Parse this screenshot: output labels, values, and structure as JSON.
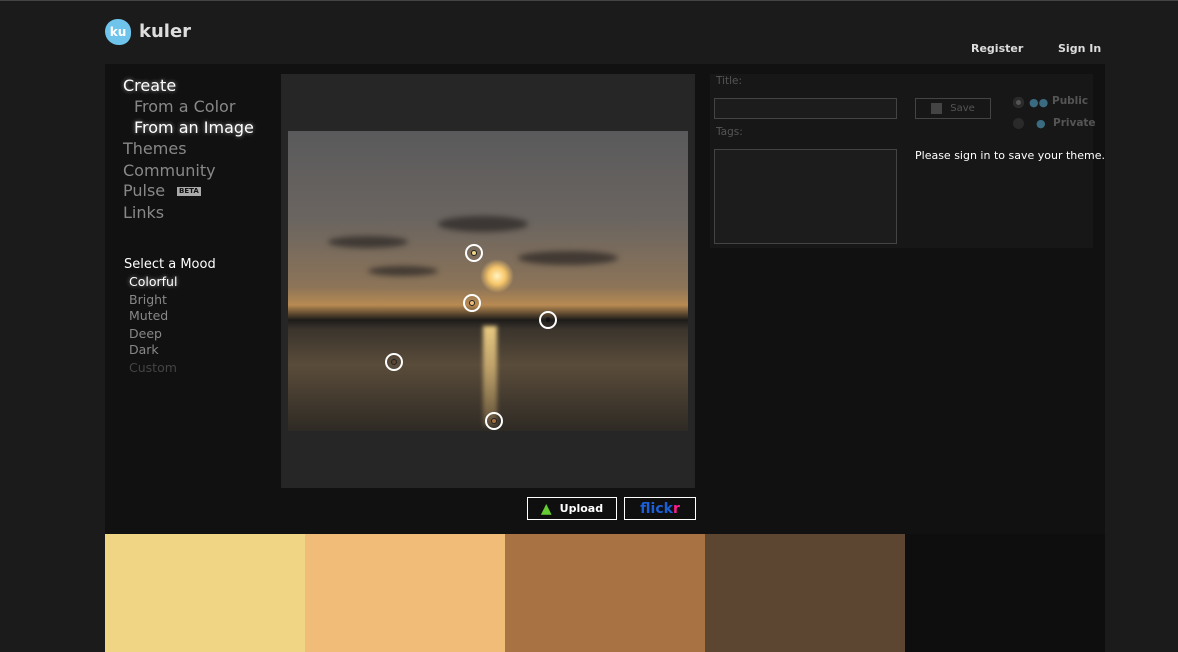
{
  "header": {
    "logo_text": "ku",
    "brand": "kuler",
    "register": "Register",
    "sign_in": "Sign In"
  },
  "nav": {
    "items": [
      {
        "label": "Create",
        "active": true
      },
      {
        "label": "From a Color",
        "active": false
      },
      {
        "label": "From an Image",
        "active": true
      },
      {
        "label": "Themes",
        "active": false
      },
      {
        "label": "Community",
        "active": false
      },
      {
        "label": "Pulse",
        "active": false
      },
      {
        "label": "Links",
        "active": false
      }
    ],
    "beta_badge": "BETA"
  },
  "mood": {
    "heading": "Select a Mood",
    "options": [
      "Colorful",
      "Bright",
      "Muted",
      "Deep",
      "Dark",
      "Custom"
    ],
    "selected": "Colorful"
  },
  "image_actions": {
    "upload": "Upload",
    "flickr": "flickr"
  },
  "form": {
    "title_label": "Title:",
    "title_value": "",
    "tags_label": "Tags:",
    "tags_value": "",
    "save": "Save",
    "public": "Public",
    "private": "Private",
    "visibility_selected": "Public",
    "message": "Please sign in to save your theme."
  },
  "pickers": [
    {
      "color": "#F0D584"
    },
    {
      "color": "#F1BC78"
    },
    {
      "color": "#111111"
    },
    {
      "color": "#5C4631"
    },
    {
      "color": "#A87243"
    }
  ],
  "swatches": [
    "#F0D584",
    "#F1BC78",
    "#A87243",
    "#5C4631",
    "#0E0E0E"
  ]
}
